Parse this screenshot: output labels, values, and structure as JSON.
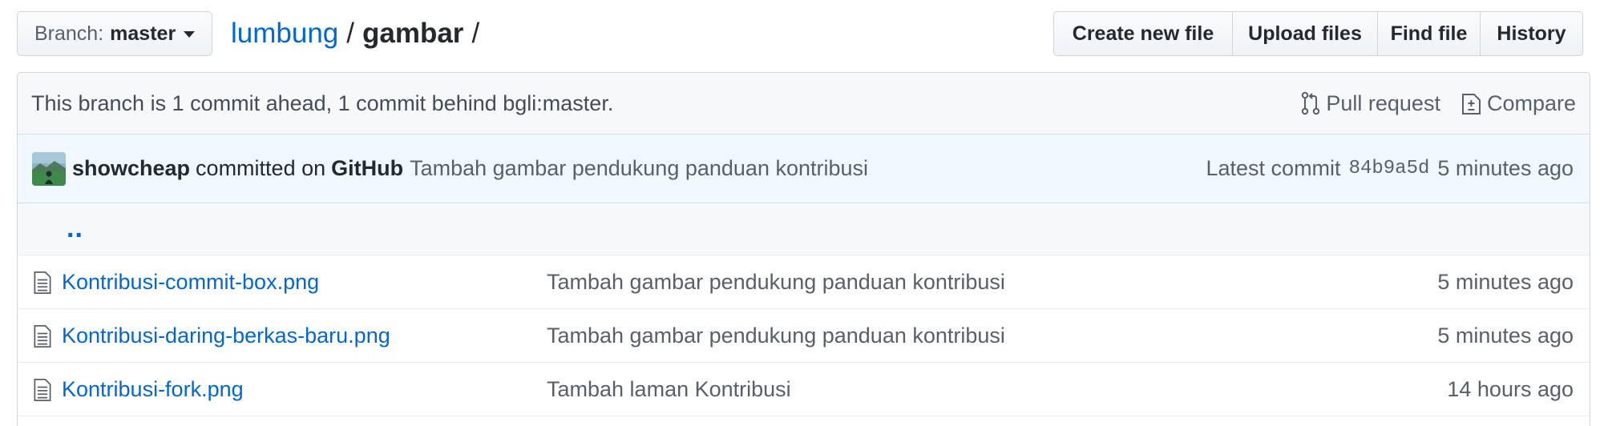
{
  "toolbar": {
    "branch_prefix": "Branch:",
    "branch_name": "master",
    "breadcrumb": {
      "repo": "lumbung",
      "separator": "/",
      "dir": "gambar",
      "trailing": "/"
    },
    "buttons": [
      "Create new file",
      "Upload files",
      "Find file",
      "History"
    ]
  },
  "branch_info": {
    "text": "This branch is 1 commit ahead, 1 commit behind bgli:master.",
    "pull_request_label": "Pull request",
    "compare_label": "Compare",
    "pull_request_icon": "git-pull-request-icon",
    "compare_icon": "diff-icon"
  },
  "commit": {
    "author": "showcheap",
    "committed_on": "committed on",
    "platform": "GitHub",
    "message": "Tambah gambar pendukung panduan kontribusi",
    "latest_label": "Latest commit",
    "sha": "84b9a5d",
    "age": "5 minutes ago"
  },
  "up_link": "..",
  "files": [
    {
      "name": "Kontribusi-commit-box.png",
      "message": "Tambah gambar pendukung panduan kontribusi",
      "age": "5 minutes ago",
      "icon": "file-icon"
    },
    {
      "name": "Kontribusi-daring-berkas-baru.png",
      "message": "Tambah gambar pendukung panduan kontribusi",
      "age": "5 minutes ago",
      "icon": "file-icon"
    },
    {
      "name": "Kontribusi-fork.png",
      "message": "Tambah laman Kontribusi",
      "age": "14 hours ago",
      "icon": "file-icon"
    }
  ],
  "colors": {
    "link": "#0366d6",
    "muted": "#586069",
    "commit_bg": "#f1f8ff",
    "info_bg": "#f6f8fa"
  }
}
